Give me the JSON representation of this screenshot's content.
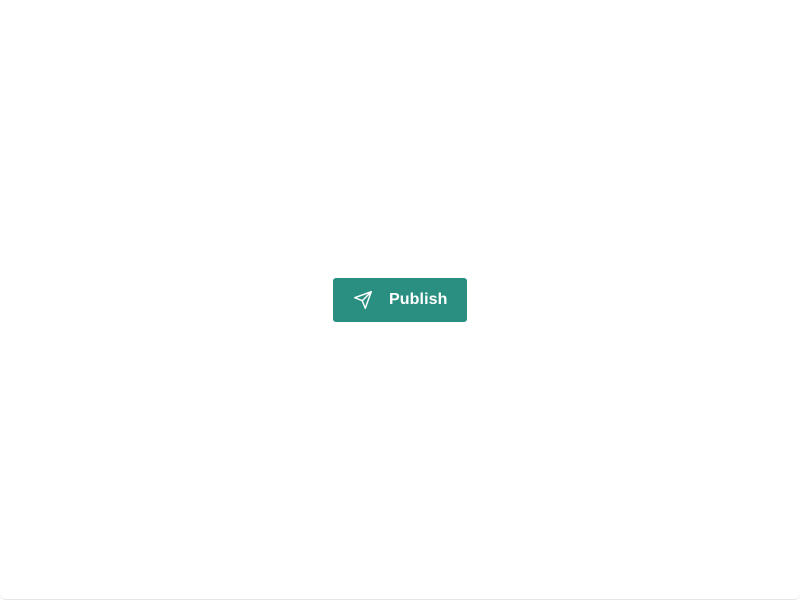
{
  "publish_button": {
    "label": "Publish",
    "icon": "send-icon",
    "background_color": "#2a8f80",
    "text_color": "#ffffff"
  }
}
